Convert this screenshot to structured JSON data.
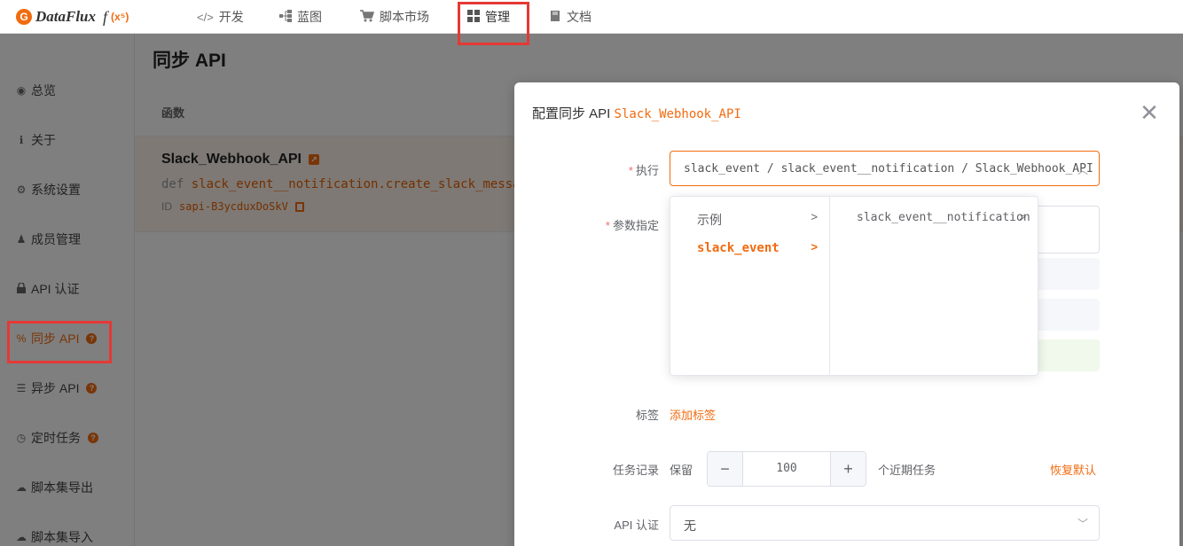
{
  "topbar": {
    "logo_text": "DataFlux",
    "logo_func": "f",
    "logo_sup": "(x⁵)",
    "nav": [
      {
        "label": "开发",
        "icon": "code-icon"
      },
      {
        "label": "蓝图",
        "icon": "sitemap-icon"
      },
      {
        "label": "脚本市场",
        "icon": "cart-icon"
      },
      {
        "label": "管理",
        "icon": "grid-icon"
      },
      {
        "label": "文档",
        "icon": "book-icon"
      }
    ]
  },
  "sidebar": {
    "items": [
      {
        "label": "总览",
        "icon": "dashboard-icon"
      },
      {
        "label": "关于",
        "icon": "info-icon"
      },
      {
        "label": "系统设置",
        "icon": "gear-icon"
      },
      {
        "label": "成员管理",
        "icon": "users-icon"
      },
      {
        "label": "API 认证",
        "icon": "lock-icon"
      },
      {
        "label": "同步 API",
        "icon": "link-icon",
        "active": true
      },
      {
        "label": "异步 API",
        "icon": "list-icon"
      },
      {
        "label": "定时任务",
        "icon": "clock-icon"
      },
      {
        "label": "脚本集导出",
        "icon": "cloud-download-icon"
      },
      {
        "label": "脚本集导入",
        "icon": "cloud-upload-icon"
      }
    ]
  },
  "main": {
    "title": "同步 API",
    "column_header": "函数",
    "row": {
      "name": "Slack_Webhook_API",
      "def_keyword": "def",
      "def_code": "slack_event__notification.create_slack_message",
      "id_label": "ID",
      "id_value": "sapi-B3ycduxDoSkV"
    }
  },
  "dialog": {
    "title_prefix": "配置同步 API",
    "title_code": "Slack_Webhook_API",
    "exec_label": "执行",
    "exec_value": "slack_event / slack_event__notification / Slack_Webhook_API",
    "params_label": "参数指定",
    "tags_label": "标签",
    "add_tag": "添加标签",
    "task_label": "任务记录",
    "keep_label": "保留",
    "task_value": "100",
    "task_suffix": "个近期任务",
    "restore_default": "恢复默认",
    "auth_label": "API 认证",
    "auth_value": "无"
  },
  "cascader": {
    "col1": [
      {
        "label": "示例"
      },
      {
        "label": "slack_event",
        "active": true
      }
    ],
    "col2": [
      {
        "label": "slack_event__notification"
      }
    ]
  },
  "colors": {
    "accent": "#f26b0f",
    "highlight_box": "#e53935"
  }
}
